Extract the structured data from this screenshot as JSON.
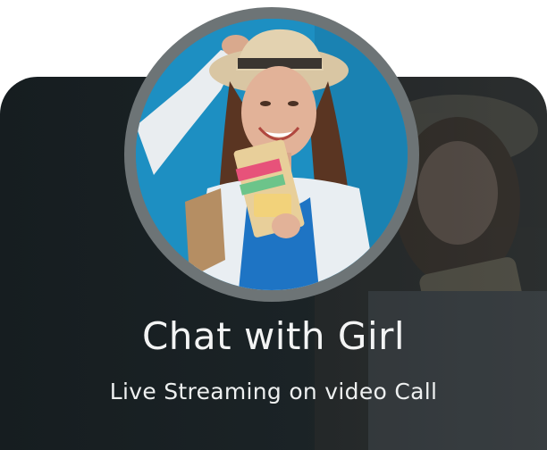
{
  "header": {
    "title": "Chat with Girl",
    "subtitle": "Live Streaming on video Call"
  },
  "colors": {
    "card_background": "#1b2326",
    "avatar_ring": "#6d7476",
    "photo_background": "#1d8fc2",
    "text": "#f3f4f4"
  }
}
